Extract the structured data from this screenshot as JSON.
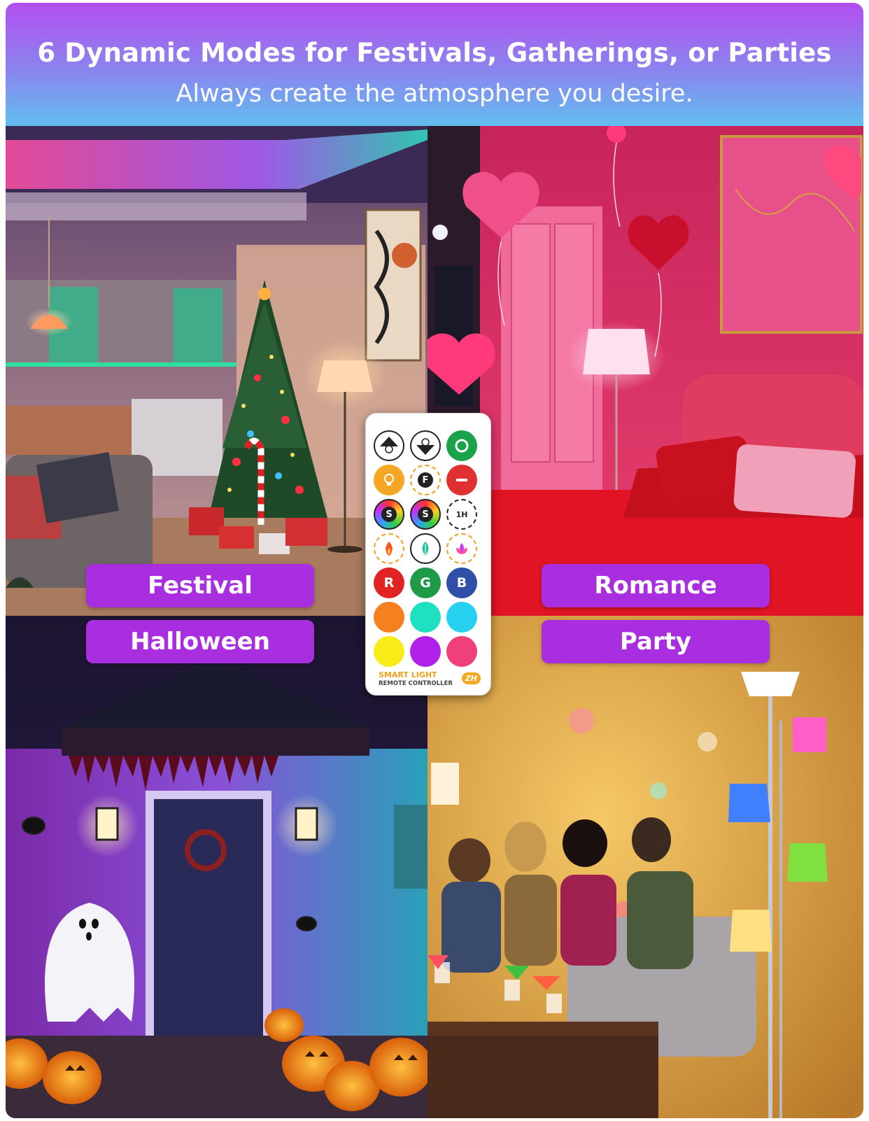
{
  "header": {
    "title": "6 Dynamic Modes for Festivals, Gatherings, or Parties",
    "subtitle": "Always create the atmosphere you desire."
  },
  "modes": {
    "festival": "Festival",
    "romance": "Romance",
    "halloween": "Halloween",
    "party": "Party"
  },
  "remote": {
    "brand_line1": "SMART LIGHT",
    "brand_line2": "REMOTE CONTROLLER",
    "badge": "ZH",
    "buttons": [
      {
        "icon": "brightness-up-icon",
        "color": "#ffffff"
      },
      {
        "icon": "brightness-down-icon",
        "color": "#ffffff"
      },
      {
        "icon": "power-on-icon",
        "color": "#1aa34a"
      },
      {
        "icon": "warm-white-icon",
        "color": "#f5a623"
      },
      {
        "icon": "flash-icon",
        "text": "F",
        "color": "#ffffff"
      },
      {
        "icon": "power-off-icon",
        "color": "#e03030"
      },
      {
        "icon": "smooth-mode-icon",
        "text": "S",
        "color": "#ffffff"
      },
      {
        "icon": "strobe-mode-icon",
        "text": "S",
        "color": "#ffffff"
      },
      {
        "icon": "timer-icon",
        "text": "1H",
        "color": "#ffffff"
      },
      {
        "icon": "fire-mode-icon",
        "color": "#ffffff"
      },
      {
        "icon": "leaf-mode-icon",
        "color": "#ffffff"
      },
      {
        "icon": "lotus-mode-icon",
        "color": "#ffffff"
      },
      {
        "icon": "red-button",
        "text": "R",
        "color": "#e02424"
      },
      {
        "icon": "green-button",
        "text": "G",
        "color": "#1f9a46"
      },
      {
        "icon": "blue-button",
        "text": "B",
        "color": "#2f4fa8"
      },
      {
        "icon": "orange-button",
        "color": "#f5801f"
      },
      {
        "icon": "aqua-button",
        "color": "#1fe0c0"
      },
      {
        "icon": "cyan-button",
        "color": "#28d0f0"
      },
      {
        "icon": "yellow-button",
        "color": "#f8ec18"
      },
      {
        "icon": "purple-button",
        "color": "#b020e8"
      },
      {
        "icon": "pink-button",
        "color": "#f0407a"
      }
    ]
  }
}
